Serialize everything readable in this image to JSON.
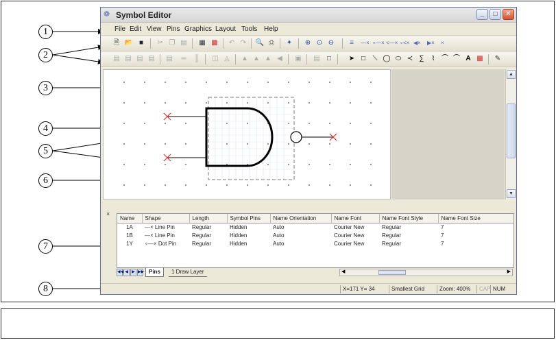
{
  "window": {
    "title": "Symbol Editor"
  },
  "menubar": {
    "items": [
      "File",
      "Edit",
      "View",
      "Pins",
      "Graphics",
      "Layout",
      "Tools",
      "Help"
    ]
  },
  "callouts": [
    "1",
    "2",
    "3",
    "4",
    "5",
    "6",
    "7",
    "8"
  ],
  "table": {
    "columns": [
      "Name",
      "Shape",
      "Length",
      "Symbol Pins",
      "Name Orientation",
      "Name Font",
      "Name Font Style",
      "Name Font Size"
    ],
    "rows": [
      [
        "1A",
        "Line Pin",
        "Regular",
        "Hidden",
        "Auto",
        "Courier New",
        "Regular",
        "7"
      ],
      [
        "1B",
        "Line Pin",
        "Regular",
        "Hidden",
        "Auto",
        "Courier New",
        "Regular",
        "7"
      ],
      [
        "1Y",
        "Dot Pin",
        "Regular",
        "Hidden",
        "Auto",
        "Courier New",
        "Regular",
        "7"
      ]
    ]
  },
  "tabs": {
    "active": "Pins",
    "inactive": "1 Draw Layer"
  },
  "statusbar": {
    "coords": "X=171 Y= 34",
    "grid": "Smallest Grid",
    "zoom": "Zoom: 400%",
    "cap": "CAP",
    "num": "NUM"
  },
  "caption": ""
}
